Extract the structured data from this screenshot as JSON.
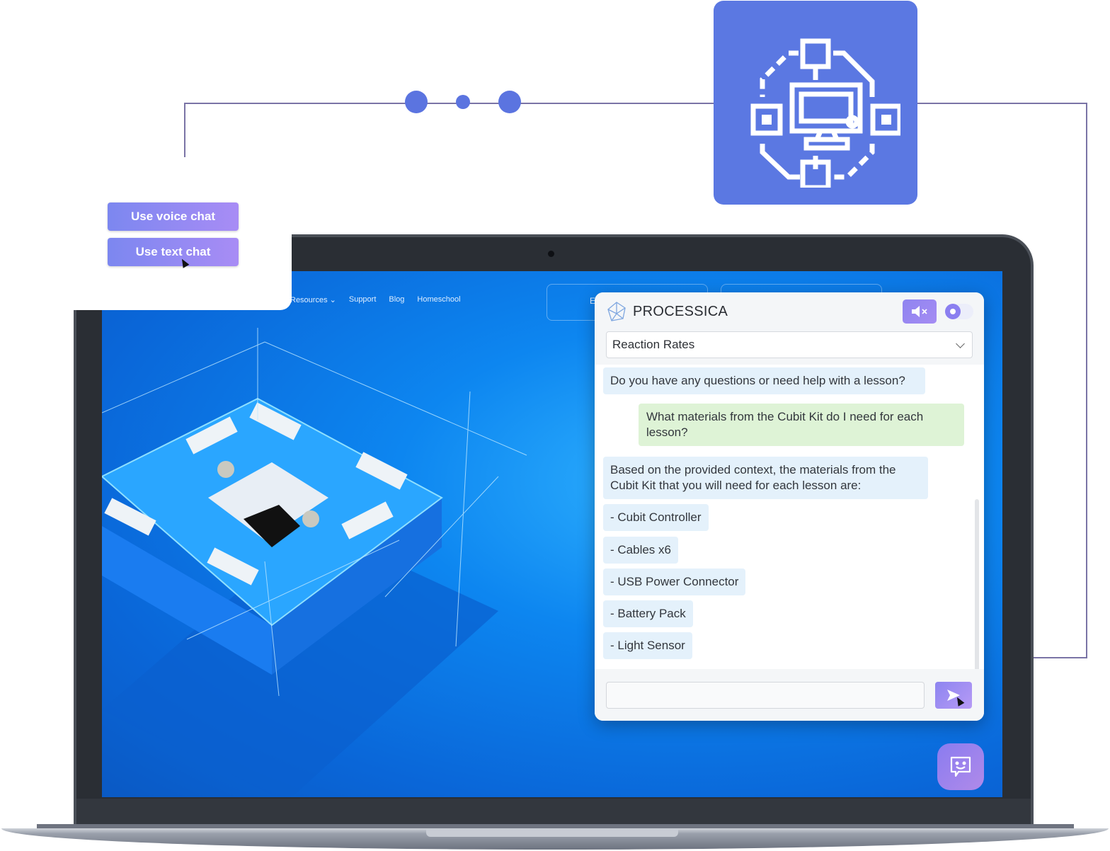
{
  "popup": {
    "voice_button": "Use voice chat",
    "text_button": "Use text chat"
  },
  "network_tile": {
    "icon": "network-computer-icon",
    "color": "#5b78e2"
  },
  "website": {
    "nav": [
      "Resources",
      "Support",
      "Blog",
      "Homeschool"
    ],
    "nav_dropdown_item": "Resources",
    "nav_box_label": "E"
  },
  "chat": {
    "brand": "PROCESSICA",
    "brand_icon": "polyhedron-logo-icon",
    "mute_icon": "speaker-muted-icon",
    "lesson_select": {
      "value": "Reaction Rates"
    },
    "messages": [
      {
        "role": "assistant",
        "text": "Do you have any questions or need help with a lesson?"
      },
      {
        "role": "user",
        "text": "What materials from the Cubit Kit do I need for each lesson?"
      },
      {
        "role": "assistant",
        "text": "Based on the provided context, the materials from the Cubit Kit that you will need for each lesson are:"
      },
      {
        "role": "assistant",
        "text": "- Cubit Controller"
      },
      {
        "role": "assistant",
        "text": "- Cables x6"
      },
      {
        "role": "assistant",
        "text": "- USB Power Connector"
      },
      {
        "role": "assistant",
        "text": "- Battery Pack"
      },
      {
        "role": "assistant",
        "text": "- Light Sensor"
      }
    ],
    "input": {
      "value": "",
      "placeholder": ""
    },
    "send_icon": "send-icon",
    "launcher_icon": "smiley-chat-icon"
  },
  "colors": {
    "accent": "#8b7ff0",
    "user_bubble": "#def3d6",
    "assistant_bubble": "#e4f1fb",
    "connector": "#7a74a6",
    "dots": "#5b74e0"
  }
}
